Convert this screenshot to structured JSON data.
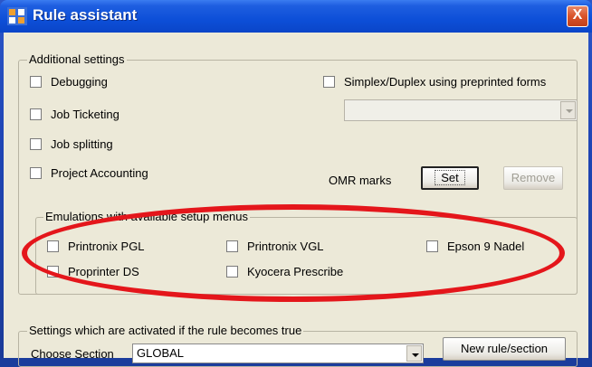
{
  "window": {
    "title": "Rule assistant",
    "close_label": "X"
  },
  "additional": {
    "legend": "Additional settings",
    "debugging": "Debugging",
    "job_ticketing": "Job Ticketing",
    "job_splitting": "Job splitting",
    "project_accounting": "Project Accounting",
    "simplex_duplex": "Simplex/Duplex  using preprinted forms",
    "omr_label": "OMR marks",
    "set_button": "Set",
    "remove_button": "Remove"
  },
  "emulations": {
    "legend": "Emulations with available setup menus",
    "items": [
      "Printronix PGL",
      "Printronix VGL",
      "Epson 9 Nadel",
      "Proprinter DS",
      "Kyocera Prescribe"
    ]
  },
  "settings": {
    "legend": "Settings which are activated if the rule becomes true",
    "choose_section_label": "Choose Section",
    "section_value": "GLOBAL",
    "new_rule_button": "New rule/section"
  },
  "colors": {
    "highlight_oval": "#e4161b",
    "titlebar": "#0a45c8"
  }
}
